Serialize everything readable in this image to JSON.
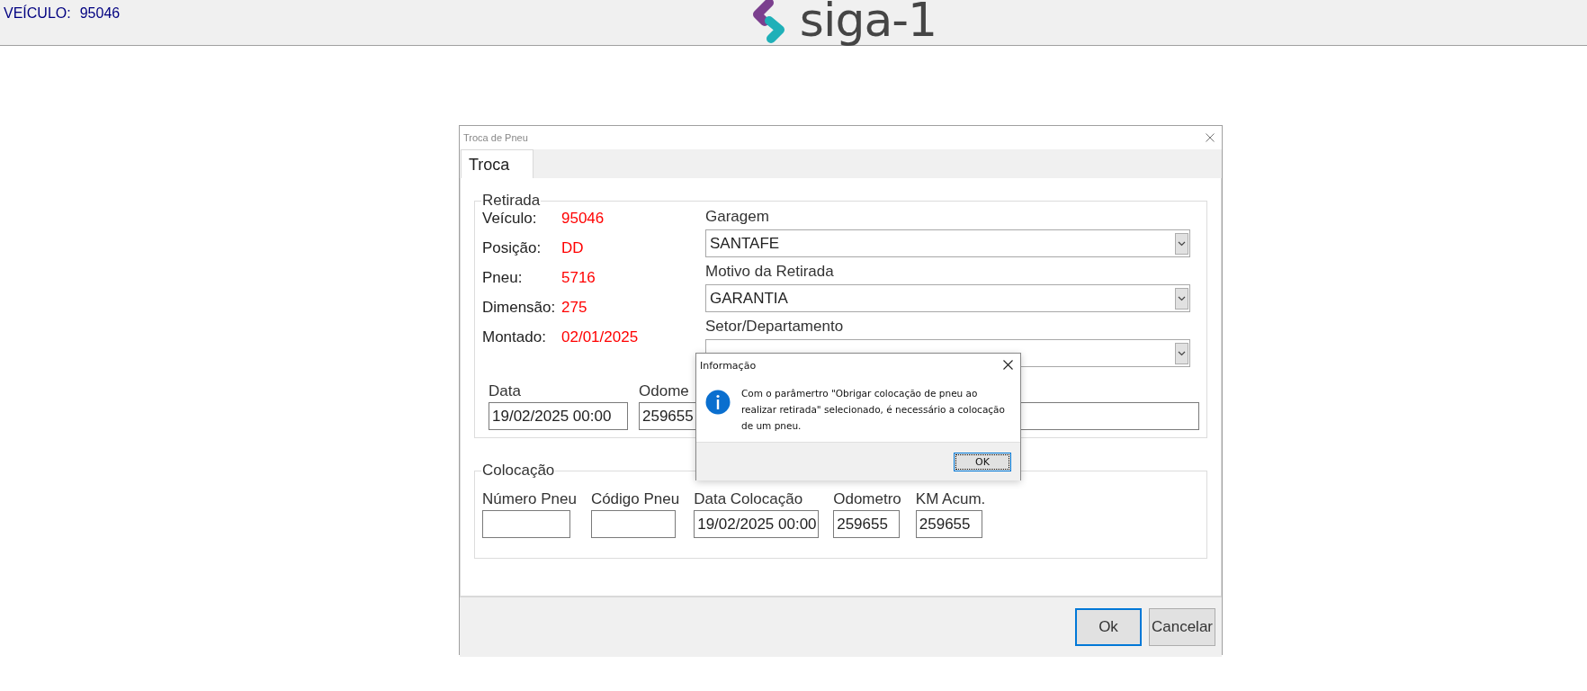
{
  "header": {
    "vehicle_label": "VEÍCULO:",
    "vehicle_number": "95046",
    "logo_text": "siga-1"
  },
  "window": {
    "title": "Troca de Pneu",
    "tabs": [
      {
        "label": "Troca",
        "selected": true
      }
    ],
    "retirada": {
      "title": "Retirada",
      "details": [
        {
          "label": "Veículo:",
          "value": "95046"
        },
        {
          "label": "Posição:",
          "value": "DD"
        },
        {
          "label": "Pneu:",
          "value": "5716"
        },
        {
          "label": "Dimensão:",
          "value": "275"
        },
        {
          "label": "Montado:",
          "value": "02/01/2025"
        }
      ],
      "selects": [
        {
          "label": "Garagem",
          "value": "SANTAFE"
        },
        {
          "label": "Motivo da Retirada",
          "value": "GARANTIA"
        },
        {
          "label": "Setor/Departamento"
        }
      ],
      "fields": [
        {
          "label": "Data",
          "value": "19/02/2025 00:00"
        },
        {
          "label": "Odome",
          "value": "259655"
        }
      ]
    },
    "colocacao": {
      "title": "Colocação",
      "fields": [
        {
          "label": "Número Pneu"
        },
        {
          "label": "Código Pneu"
        },
        {
          "label": "Data Colocação",
          "value": "19/02/2025 00:00"
        },
        {
          "label": "Odometro",
          "value": "259655"
        },
        {
          "label": "KM Acum.",
          "value": "259655"
        }
      ]
    },
    "buttons": [
      {
        "label": "Ok",
        "default": true
      },
      {
        "label": "Cancelar",
        "default": false
      }
    ]
  },
  "message_box": {
    "title": "Informação",
    "message": "Com o parâmertro \"Obrigar colocação de pneu ao realizar retirada\" selecionado, é necessário a colocação de um pneu.",
    "buttons": [
      {
        "label": "OK",
        "default": true
      }
    ]
  }
}
